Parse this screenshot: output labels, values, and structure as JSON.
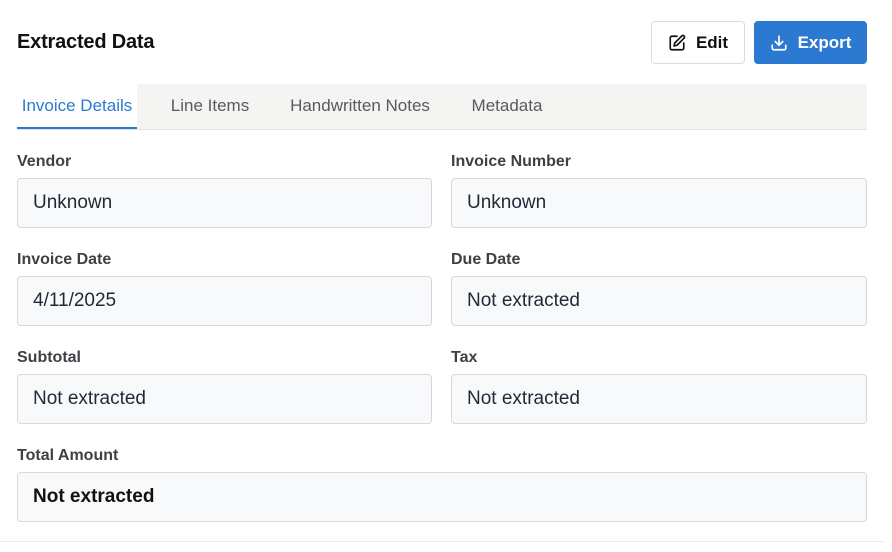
{
  "header": {
    "title": "Extracted Data",
    "edit_label": "Edit",
    "export_label": "Export",
    "accent_color": "#2b79d0"
  },
  "tabs": [
    {
      "label": "Invoice Details",
      "active": true
    },
    {
      "label": "Line Items",
      "active": false
    },
    {
      "label": "Handwritten Notes",
      "active": false
    },
    {
      "label": "Metadata",
      "active": false
    }
  ],
  "fields": {
    "vendor": {
      "label": "Vendor",
      "value": "Unknown"
    },
    "invoice_number": {
      "label": "Invoice Number",
      "value": "Unknown"
    },
    "invoice_date": {
      "label": "Invoice Date",
      "value": "4/11/2025"
    },
    "due_date": {
      "label": "Due Date",
      "value": "Not extracted"
    },
    "subtotal": {
      "label": "Subtotal",
      "value": "Not extracted"
    },
    "tax": {
      "label": "Tax",
      "value": "Not extracted"
    },
    "total_amount": {
      "label": "Total Amount",
      "value": "Not extracted"
    }
  }
}
